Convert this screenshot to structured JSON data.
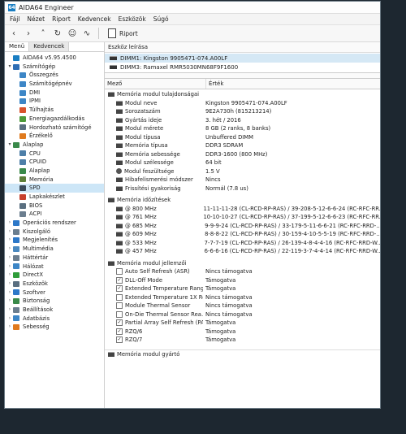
{
  "window": {
    "title": "AIDA64 Engineer",
    "logo_text": "64"
  },
  "menu": [
    "Fájl",
    "Nézet",
    "Riport",
    "Kedvencek",
    "Eszközök",
    "Súgó"
  ],
  "toolbar": {
    "report_label": "Riport"
  },
  "left_panel": {
    "tabs": [
      "Menü",
      "Kedvencek"
    ],
    "tree": [
      {
        "label": "AIDA64 v5.95.4500",
        "level": 0,
        "expanded": null,
        "icon": "aida-icon",
        "color": "#1a7ec2"
      },
      {
        "label": "Számítógép",
        "level": 0,
        "expanded": true,
        "icon": "computer-icon",
        "color": "#2f6fb5"
      },
      {
        "label": "Összegzés",
        "level": 1,
        "icon": "summary-icon",
        "color": "#3d86c6"
      },
      {
        "label": "Számítógépnév",
        "level": 1,
        "icon": "computer-name-icon",
        "color": "#3d86c6"
      },
      {
        "label": "DMI",
        "level": 1,
        "icon": "dmi-icon",
        "color": "#3d86c6"
      },
      {
        "label": "IPMI",
        "level": 1,
        "icon": "ipmi-icon",
        "color": "#3d86c6"
      },
      {
        "label": "Túlhajtás",
        "level": 1,
        "icon": "flame-icon",
        "color": "#d9532c"
      },
      {
        "label": "Energiagazdálkodás",
        "level": 1,
        "icon": "power-icon",
        "color": "#4d9a3a"
      },
      {
        "label": "Hordozható számítógé",
        "level": 1,
        "icon": "laptop-icon",
        "color": "#5a6f80"
      },
      {
        "label": "Érzékelő",
        "level": 1,
        "icon": "sensor-icon",
        "color": "#e07a1e"
      },
      {
        "label": "Alaplap",
        "level": 0,
        "expanded": true,
        "icon": "motherboard-icon",
        "color": "#3a8a4a"
      },
      {
        "label": "CPU",
        "level": 1,
        "icon": "cpu-icon",
        "color": "#4e7fa8"
      },
      {
        "label": "CPUID",
        "level": 1,
        "icon": "cpuid-icon",
        "color": "#4e7fa8"
      },
      {
        "label": "Alaplap",
        "level": 1,
        "icon": "board-icon",
        "color": "#3a8a4a"
      },
      {
        "label": "Memória",
        "level": 1,
        "icon": "memory-icon",
        "color": "#5d7f3a"
      },
      {
        "label": "SPD",
        "level": 1,
        "icon": "spd-icon",
        "color": "#3a4a5a",
        "selected": true
      },
      {
        "label": "Lapkakészlet",
        "level": 1,
        "icon": "chipset-icon",
        "color": "#c7402d"
      },
      {
        "label": "BIOS",
        "level": 1,
        "icon": "bios-icon",
        "color": "#5a6f80"
      },
      {
        "label": "ACPI",
        "level": 1,
        "icon": "acpi-icon",
        "color": "#6b7e8f"
      },
      {
        "label": "Operációs rendszer",
        "level": 0,
        "expanded": false,
        "icon": "os-icon",
        "color": "#2d78c8"
      },
      {
        "label": "Kiszolgáló",
        "level": 0,
        "expanded": false,
        "icon": "server-icon",
        "color": "#6b7e8f"
      },
      {
        "label": "Megjelenítés",
        "level": 0,
        "expanded": false,
        "icon": "display-icon",
        "color": "#2d78c8"
      },
      {
        "label": "Multimédia",
        "level": 0,
        "expanded": false,
        "icon": "multimedia-icon",
        "color": "#4a89c0"
      },
      {
        "label": "Háttértár",
        "level": 0,
        "expanded": false,
        "icon": "storage-icon",
        "color": "#6b7e8f"
      },
      {
        "label": "Hálózat",
        "level": 0,
        "expanded": false,
        "icon": "network-icon",
        "color": "#3d86c6"
      },
      {
        "label": "DirectX",
        "level": 0,
        "expanded": false,
        "icon": "directx-icon",
        "color": "#2f9d3a"
      },
      {
        "label": "Eszközök",
        "level": 0,
        "expanded": false,
        "icon": "devices-icon",
        "color": "#5a6f80"
      },
      {
        "label": "Szoftver",
        "level": 0,
        "expanded": false,
        "icon": "software-icon",
        "color": "#2d78c8"
      },
      {
        "label": "Biztonság",
        "level": 0,
        "expanded": false,
        "icon": "security-icon",
        "color": "#3a8a4a"
      },
      {
        "label": "Beállítások",
        "level": 0,
        "expanded": false,
        "icon": "settings-icon",
        "color": "#6b7e8f"
      },
      {
        "label": "Adatbázis",
        "level": 0,
        "expanded": false,
        "icon": "database-icon",
        "color": "#3d86c6"
      },
      {
        "label": "Sebesség",
        "level": 0,
        "expanded": false,
        "icon": "speed-icon",
        "color": "#e07a1e"
      }
    ]
  },
  "device_description": {
    "title": "Eszköz leírása",
    "devices": [
      {
        "label": "DIMM1: Kingston 9905471-074.A00LF",
        "selected": true
      },
      {
        "label": "DIMM3: Ramaxel RMR5030MN68F9F1600",
        "selected": false
      }
    ]
  },
  "columns": {
    "field": "Mező",
    "value": "Érték"
  },
  "groups": [
    {
      "title": "Memória modul tulajdonságai",
      "rows": [
        {
          "field": "Modul neve",
          "value": "Kingston 9905471-074.A00LF",
          "icon": "chip"
        },
        {
          "field": "Sorozatszám",
          "value": "9E2A730h (815213214)",
          "icon": "chip"
        },
        {
          "field": "Gyártás ideje",
          "value": "3. hét / 2016",
          "icon": "chip"
        },
        {
          "field": "Modul mérete",
          "value": "8 GB (2 ranks, 8 banks)",
          "icon": "chip"
        },
        {
          "field": "Modul típusa",
          "value": "Unbuffered DIMM",
          "icon": "chip"
        },
        {
          "field": "Memória típusa",
          "value": "DDR3 SDRAM",
          "icon": "chip"
        },
        {
          "field": "Memória sebessége",
          "value": "DDR3-1600 (800 MHz)",
          "icon": "chip"
        },
        {
          "field": "Modul szélessége",
          "value": "64 bit",
          "icon": "chip"
        },
        {
          "field": "Modul feszültsége",
          "value": "1.5 V",
          "icon": "voltage"
        },
        {
          "field": "Hibafelismerési módszer",
          "value": "Nincs",
          "icon": "chip"
        },
        {
          "field": "Frissítési gyakoriság",
          "value": "Normál (7.8 us)",
          "icon": "chip"
        }
      ]
    },
    {
      "title": "Memória időzítések",
      "rows": [
        {
          "field": "@ 800 MHz",
          "value": "11-11-11-28  (CL-RCD-RP-RAS) / 39-208-5-12-6-6-24  (RC-RFC-RR...",
          "icon": "chip"
        },
        {
          "field": "@ 761 MHz",
          "value": "10-10-10-27  (CL-RCD-RP-RAS) / 37-199-5-12-6-6-23  (RC-RFC-RR...",
          "icon": "chip"
        },
        {
          "field": "@ 685 MHz",
          "value": "9-9-9-24  (CL-RCD-RP-RAS) / 33-179-5-11-6-6-21  (RC-RFC-RRD-...",
          "icon": "chip"
        },
        {
          "field": "@ 609 MHz",
          "value": "8-8-8-22  (CL-RCD-RP-RAS) / 30-159-4-10-5-5-19  (RC-RFC-RRD-...",
          "icon": "chip"
        },
        {
          "field": "@ 533 MHz",
          "value": "7-7-7-19  (CL-RCD-RP-RAS) / 26-139-4-8-4-4-16  (RC-RFC-RRD-W...",
          "icon": "chip"
        },
        {
          "field": "@ 457 MHz",
          "value": "6-6-6-16  (CL-RCD-RP-RAS) / 22-119-3-7-4-4-14  (RC-RFC-RRD-W...",
          "icon": "chip"
        }
      ]
    },
    {
      "title": "Memória modul jellemzői",
      "rows": [
        {
          "field": "Auto Self Refresh (ASR)",
          "value": "Nincs támogatva",
          "checked": false
        },
        {
          "field": "DLL-Off Mode",
          "value": "Támogatva",
          "checked": true
        },
        {
          "field": "Extended Temperature Range",
          "value": "Támogatva",
          "checked": true
        },
        {
          "field": "Extended Temperature 1X Re...",
          "value": "Nincs támogatva",
          "checked": false
        },
        {
          "field": "Module Thermal Sensor",
          "value": "Nincs támogatva",
          "checked": false
        },
        {
          "field": "On-Die Thermal Sensor Rea...",
          "value": "Nincs támogatva",
          "checked": false
        },
        {
          "field": "Partial Array Self Refresh (PA...",
          "value": "Támogatva",
          "checked": true
        },
        {
          "field": "RZQ/6",
          "value": "Támogatva",
          "checked": true
        },
        {
          "field": "RZQ/7",
          "value": "Támogatva",
          "checked": true
        }
      ]
    }
  ],
  "footer": {
    "label": "Memória modul gyártó"
  }
}
